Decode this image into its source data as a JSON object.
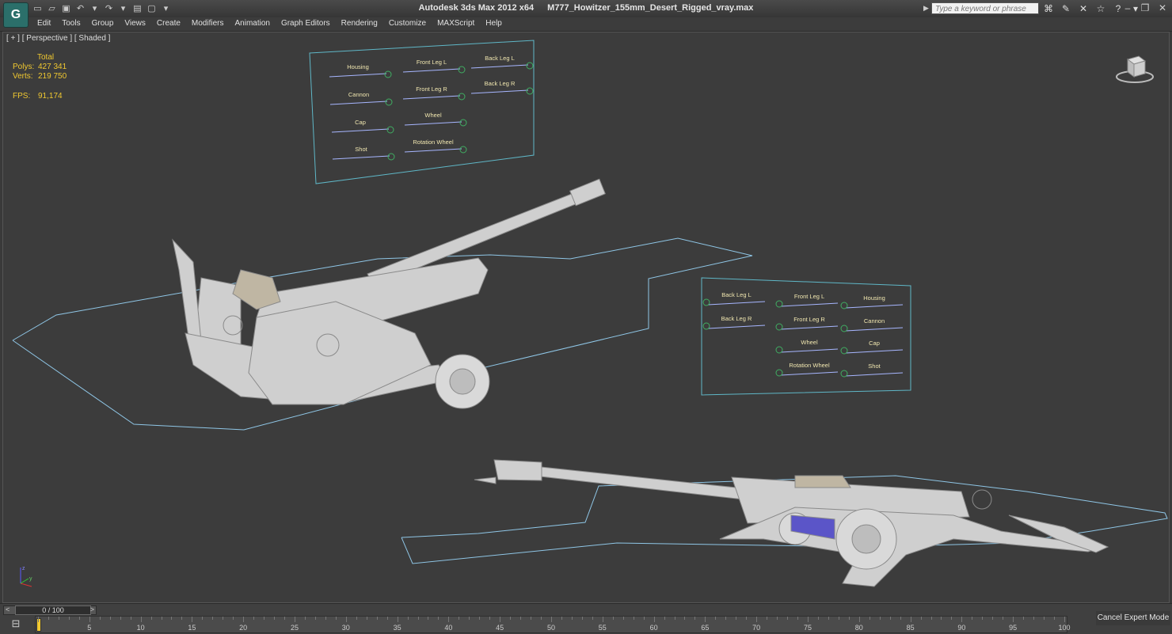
{
  "titlebar": {
    "app_title": "Autodesk 3ds Max  2012 x64",
    "document": "M777_Howitzer_155mm_Desert_Rigged_vray.max",
    "search_placeholder": "Type a keyword or phrase"
  },
  "menu": [
    "Edit",
    "Tools",
    "Group",
    "Views",
    "Create",
    "Modifiers",
    "Animation",
    "Graph Editors",
    "Rendering",
    "Customize",
    "MAXScript",
    "Help"
  ],
  "viewport": {
    "label": "[ + ] [ Perspective ] [ Shaded ]",
    "stats": {
      "header": "Total",
      "polys_label": "Polys:",
      "polys": "427 341",
      "verts_label": "Verts:",
      "verts": "219 750",
      "fps_label": "FPS:",
      "fps": "91,174"
    }
  },
  "panel_top": {
    "labels": [
      "Housing",
      "Front Leg L",
      "Back Leg L",
      "Cannon",
      "Front Leg R",
      "Back Leg R",
      "Cap",
      "Wheel",
      "Shot",
      "Rotation Wheel"
    ]
  },
  "panel_right": {
    "labels": [
      "Back Leg L",
      "Front Leg L",
      "Housing",
      "Back Leg R",
      "Front Leg R",
      "Cannon",
      "Wheel",
      "Cap",
      "Rotation Wheel",
      "Shot"
    ]
  },
  "timeline": {
    "slider_value": "0 / 100",
    "left_arrow": "<",
    "right_arrow": ">",
    "ticks": [
      "0",
      "5",
      "10",
      "15",
      "20",
      "25",
      "30",
      "35",
      "40",
      "45",
      "50",
      "55",
      "60",
      "65",
      "70",
      "75",
      "80",
      "85",
      "90",
      "95",
      "100"
    ],
    "expert_button": "Cancel Expert Mode"
  },
  "colors": {
    "accent": "#f0c830",
    "viewport_bg": "#3c3c3c",
    "outline": "#8fc6e6",
    "panel_border": "#5fb7c7"
  }
}
